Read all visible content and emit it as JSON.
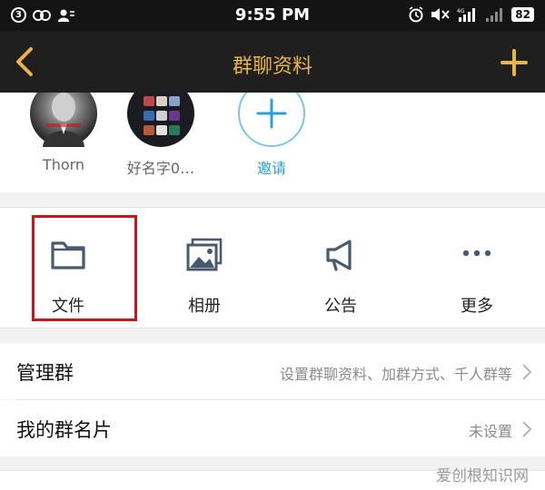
{
  "statusbar": {
    "notif_count": "3",
    "time": "9:55 PM",
    "network": "4G",
    "battery": "82"
  },
  "navbar": {
    "title": "群聊资料"
  },
  "members": [
    {
      "name": "Thorn"
    },
    {
      "name": "好名字0…"
    },
    {
      "name": "邀请"
    }
  ],
  "actions": [
    {
      "label": "文件",
      "icon": "folder-icon",
      "highlighted": true
    },
    {
      "label": "相册",
      "icon": "album-icon"
    },
    {
      "label": "公告",
      "icon": "megaphone-icon"
    },
    {
      "label": "更多",
      "icon": "more-icon"
    }
  ],
  "rows": [
    {
      "title": "管理群",
      "value": "设置群聊资料、加群方式、千人群等"
    },
    {
      "title": "我的群名片",
      "value": "未设置"
    }
  ],
  "watermark": "爱创根知识网",
  "colors": {
    "accent_gold": "#e8b34a",
    "invite_blue": "#2aa0d8",
    "highlight_red": "#c8161d",
    "icon_slate": "#4a5a6e"
  }
}
